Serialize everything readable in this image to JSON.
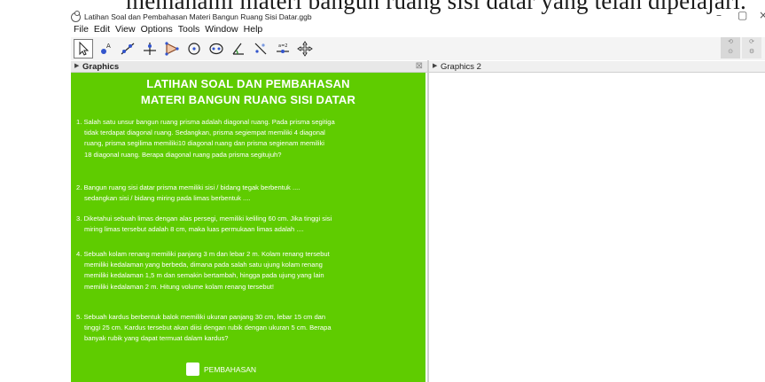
{
  "caption_text": "memahami materi bangun ruang sisi datar yang telah dipelajari.",
  "window": {
    "title": "Latihan Soal dan Pembahasan Materi Bangun Ruang Sisi Datar.ggb",
    "minimize": "–",
    "maximize": "▢",
    "close": "×"
  },
  "menu": [
    "File",
    "Edit",
    "View",
    "Options",
    "Tools",
    "Window",
    "Help"
  ],
  "toolbar": {
    "tools": [
      "move-tool",
      "point-tool",
      "line-tool",
      "perpendicular-tool",
      "polygon-tool",
      "circle-tool",
      "ellipse-tool",
      "angle-tool",
      "reflect-tool",
      "slider-tool",
      "move-view-tool"
    ],
    "right_minis": [
      "undo",
      "redo"
    ]
  },
  "views": {
    "graphics": {
      "label": "Graphics",
      "close": "⊠"
    },
    "graphics2": {
      "label": "Graphics 2"
    }
  },
  "content": {
    "heading1": "LATIHAN SOAL DAN PEMBAHASAN",
    "heading2": "MATERI BANGUN RUANG SISI DATAR",
    "q1": [
      "1. Salah satu unsur bangun ruang prisma adalah diagonal ruang. Pada prisma segitiga",
      "tidak terdapat diagonal ruang. Sedangkan, prisma segiempat memiliki 4 diagonal",
      "ruang, prisma segilima memiliki10 diagonal ruang dan prisma segienam memiliki",
      "18 diagonal ruang. Berapa diagonal ruang pada prisma segitujuh?"
    ],
    "q2": [
      "2. Bangun ruang sisi datar prisma memiliki sisi / bidang tegak berbentuk ....",
      "sedangkan sisi / bidang miring pada limas berbentuk ...."
    ],
    "q3": [
      "3. Diketahui sebuah limas dengan alas persegi, memiliki keliling 60 cm. Jika tinggi sisi",
      "miring limas tersebut adalah 8 cm, maka luas permukaan limas adalah ...."
    ],
    "q4": [
      "4. Sebuah kolam renang memiliki panjang 3 m dan lebar 2 m. Kolam renang tersebut",
      "memiliki kedalaman yang berbeda, dimana pada salah satu ujung kolam renang",
      "memiliki kedalaman 1,5 m dan semakin bertambah, hingga pada ujung yang lain",
      "memiliki kedalaman 2 m. Hitung volume kolam renang tersebut!"
    ],
    "q5": [
      "5. Sebuah kardus berbentuk balok memiliki ukuran panjang 30 cm, lebar 15 cm dan",
      "tinggi 25 cm. Kardus tersebut akan diisi dengan rubik dengan ukuran 5 cm. Berapa",
      "banyak rubik yang dapat termuat dalam kardus?"
    ],
    "checkbox_label": "PEMBAHASAN",
    "checkbox_checked": false
  },
  "colors": {
    "green_bg": "#5fcc00",
    "text_white": "#ffffff"
  }
}
